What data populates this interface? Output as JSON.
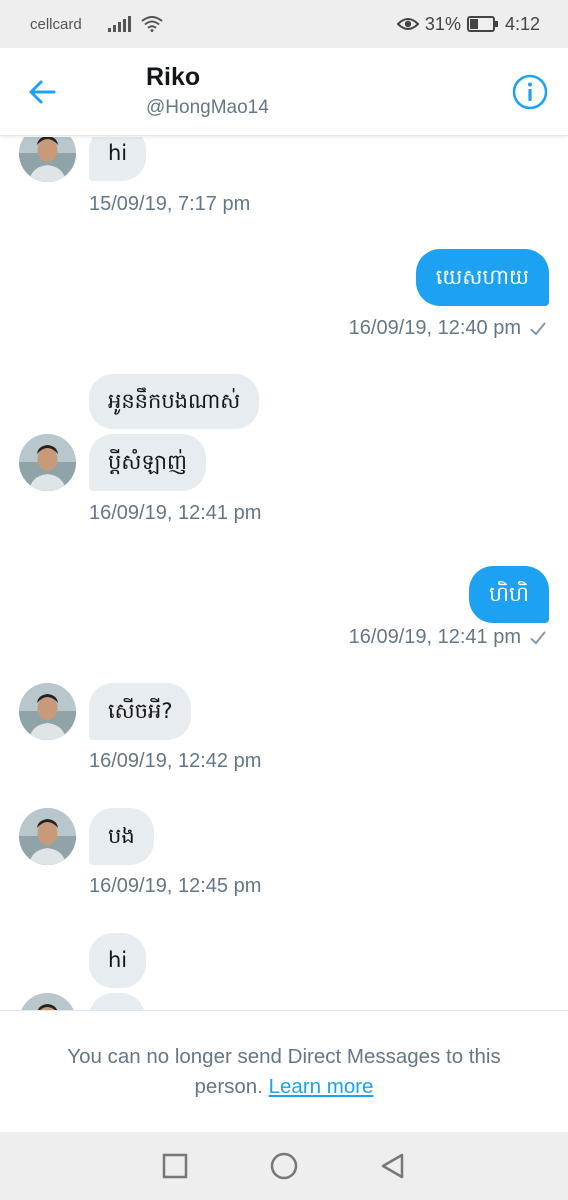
{
  "status_bar": {
    "carrier": "cellcard",
    "battery": "31%",
    "time": "4:12"
  },
  "header": {
    "name": "Riko",
    "handle": "@HongMao14",
    "accent": "#1da1f2"
  },
  "messages": [
    {
      "side": "in",
      "text": "hi"
    },
    {
      "side": "in",
      "timestamp": "15/09/19, 7:17 pm"
    },
    {
      "side": "out",
      "text": "យេសហាយ",
      "timestamp": "16/09/19, 12:40 pm"
    },
    {
      "side": "in",
      "text": "អូននឹកបងណាស់"
    },
    {
      "side": "in",
      "text": "ប្តីសំឡាញ់",
      "timestamp": "16/09/19, 12:41 pm"
    },
    {
      "side": "out",
      "text": "ហិហិ",
      "timestamp": "16/09/19, 12:41 pm"
    },
    {
      "side": "in",
      "text": "សើចអី?",
      "timestamp": "16/09/19, 12:42 pm"
    },
    {
      "side": "in",
      "text": "បង",
      "timestamp": "16/09/19, 12:45 pm"
    },
    {
      "side": "in",
      "text": "hi"
    }
  ],
  "footer": {
    "notice": "You can no longer send Direct Messages to this person.",
    "link": "Learn more"
  },
  "icons": {
    "back": "arrow-left-icon",
    "info": "info-icon",
    "read_receipt": "check-icon",
    "nav_recents": "square-icon",
    "nav_home": "circle-icon",
    "nav_back": "triangle-back-icon"
  }
}
